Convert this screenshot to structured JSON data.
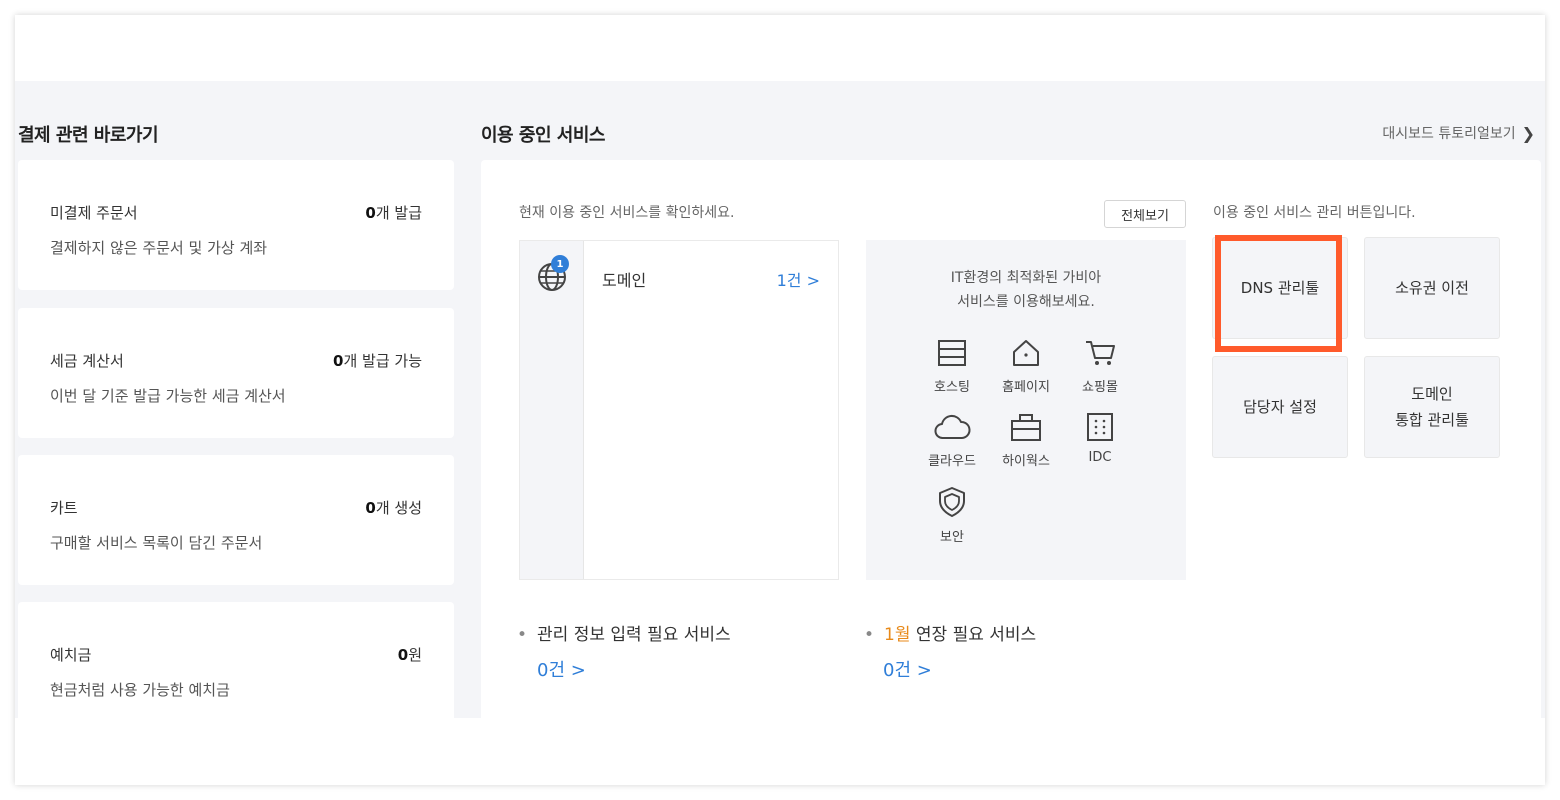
{
  "payment": {
    "title": "결제 관련 바로가기",
    "cards": [
      {
        "name": "미결제 주문서",
        "value_num": "0",
        "value_unit": "개 발급",
        "desc": "결제하지 않은 주문서 및 가상 계좌"
      },
      {
        "name": "세금 계산서",
        "value_num": "0",
        "value_unit": "개 발급 가능",
        "desc": "이번 달 기준 발급 가능한 세금 계산서"
      },
      {
        "name": "카트",
        "value_num": "0",
        "value_unit": "개 생성",
        "desc": "구매할 서비스 목록이 담긴 주문서"
      },
      {
        "name": "예치금",
        "value_num": "0",
        "value_unit": "원",
        "desc": "현금처럼 사용 가능한 예치금"
      }
    ]
  },
  "services": {
    "title": "이용 중인 서비스",
    "tutorial_label": "대시보드 튜토리얼보기",
    "hint": "현재 이용 중인 서비스를 확인하세요.",
    "view_all": "전체보기",
    "domain": {
      "badge": "1",
      "label": "도메인",
      "count": "1건 >"
    },
    "promo": {
      "line1": "IT환경의 최적화된 가비아",
      "line2": "서비스를 이용해보세요.",
      "items": [
        {
          "icon": "hosting-icon",
          "label": "호스팅"
        },
        {
          "icon": "homepage-icon",
          "label": "홈페이지"
        },
        {
          "icon": "cart-icon",
          "label": "쇼핑몰"
        },
        {
          "icon": "cloud-icon",
          "label": "클라우드"
        },
        {
          "icon": "hiworks-icon",
          "label": "하이웍스"
        },
        {
          "icon": "idc-icon",
          "label": "IDC"
        },
        {
          "icon": "security-icon",
          "label": "보안"
        }
      ]
    },
    "manage_hint": "이용 중인 서비스 관리 버튼입니다.",
    "buttons": {
      "dns": "DNS 관리툴",
      "ownership": "소유권 이전",
      "contact": "담당자 설정",
      "domain_line1": "도메인",
      "domain_line2": "통합 관리툴"
    },
    "needs_info": {
      "label": "관리 정보 입력 필요 서비스",
      "count": "0건 >"
    },
    "renewal": {
      "month": "1월",
      "label": " 연장 필요 서비스",
      "count": "0건 >"
    }
  },
  "colors": {
    "accent": "#2f7ed8",
    "highlight": "#ff5a2b",
    "month": "#e88a1a"
  }
}
